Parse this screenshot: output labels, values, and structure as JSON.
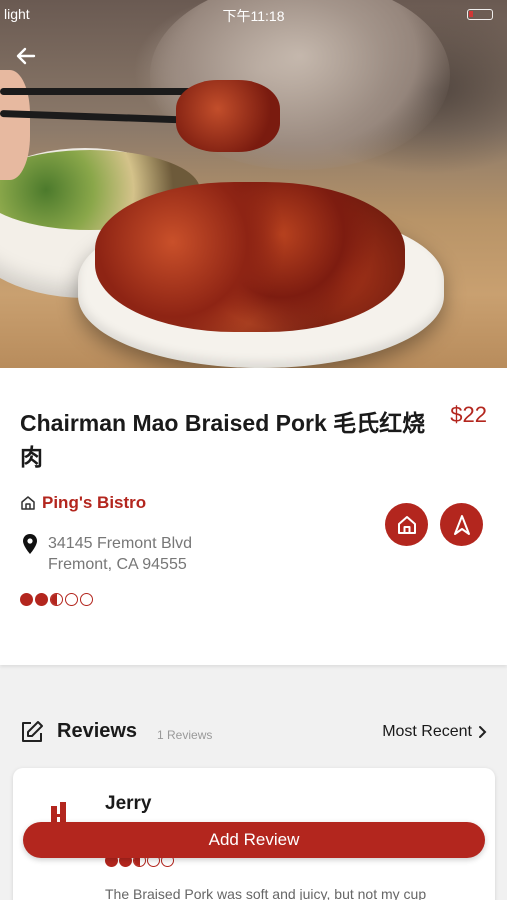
{
  "status_bar": {
    "carrier": "light",
    "time": "下午11:18"
  },
  "dish": {
    "title": "Chairman Mao Braised Pork 毛氏红烧肉",
    "price": "$22",
    "rating": 2.5,
    "rating_max": 5
  },
  "restaurant": {
    "name": "Ping's Bistro",
    "address_line1": "34145 Fremont Blvd",
    "address_line2": "Fremont, CA 94555"
  },
  "reviews": {
    "header": "Reviews",
    "count_label": "1 Reviews",
    "sort_label": "Most Recent",
    "items": [
      {
        "reviewer": "Jerry",
        "rating": 2.5,
        "text": "The Braised Pork was soft and juicy, but not my cup"
      }
    ]
  },
  "add_review_label": "Add Review",
  "colors": {
    "accent": "#b3261e",
    "background": "#f1f1f1"
  },
  "icons": {
    "back": "back-arrow-icon",
    "restaurant": "home-icon",
    "location": "location-pin-icon",
    "navigate": "navigation-arrow-icon",
    "edit": "edit-icon",
    "sort": "chevron-right-icon"
  }
}
